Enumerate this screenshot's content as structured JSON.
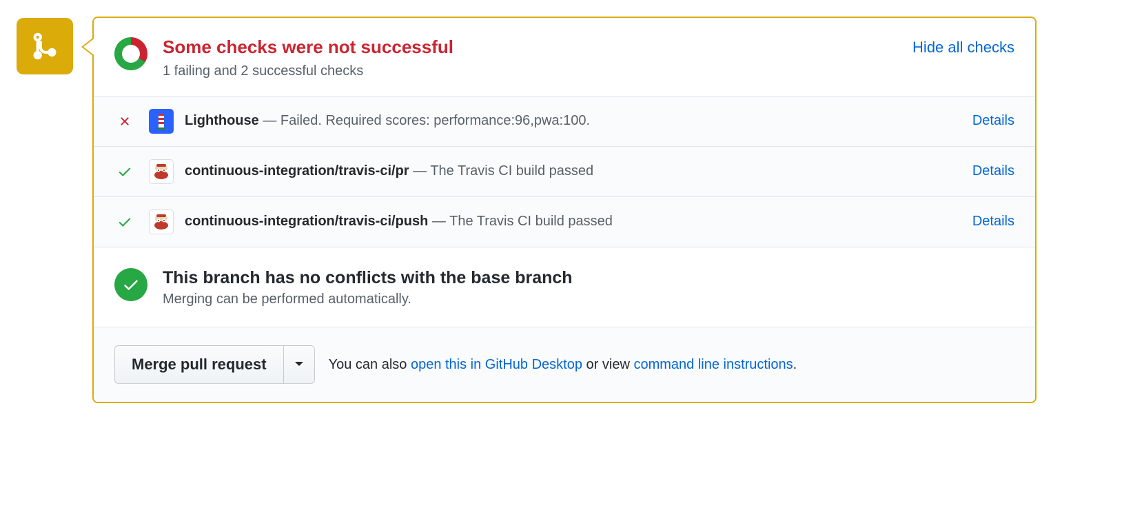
{
  "header": {
    "title": "Some checks were not successful",
    "subtitle": "1 failing and 2 successful checks",
    "hide_link": "Hide all checks"
  },
  "checks": [
    {
      "name": "Lighthouse",
      "message": "— Failed. Required scores: performance:96,pwa:100.",
      "details": "Details"
    },
    {
      "name": "continuous-integration/travis-ci/pr",
      "message": "— The Travis CI build passed",
      "details": "Details"
    },
    {
      "name": "continuous-integration/travis-ci/push",
      "message": "— The Travis CI build passed",
      "details": "Details"
    }
  ],
  "conflicts": {
    "title": "This branch has no conflicts with the base branch",
    "subtitle": "Merging can be performed automatically."
  },
  "footer": {
    "merge_button": "Merge pull request",
    "prefix": "You can also ",
    "desktop_link": "open this in GitHub Desktop",
    "middle": " or view ",
    "cli_link": "command line instructions",
    "suffix": "."
  }
}
